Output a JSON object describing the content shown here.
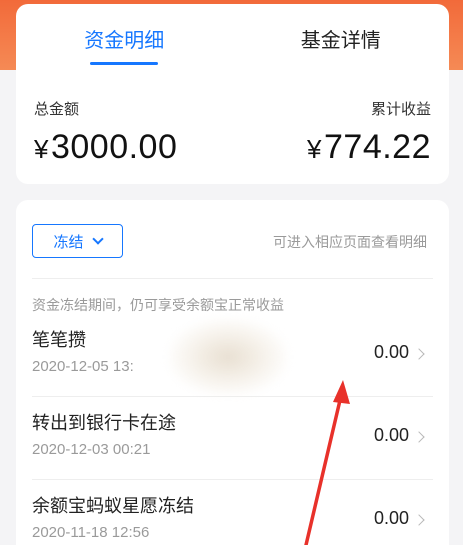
{
  "tabs": [
    {
      "label": "资金明细",
      "active": true
    },
    {
      "label": "基金详情",
      "active": false
    }
  ],
  "summary": {
    "total_label": "总金额",
    "total_currency": "¥",
    "total_value": "3000.00",
    "earnings_label": "累计收益",
    "earnings_currency": "¥",
    "earnings_value": "774.22"
  },
  "filter": {
    "selected": "冻结"
  },
  "hint_text": "可进入相应页面查看明细",
  "note_text": "资金冻结期间，仍可享受余额宝正常收益",
  "records": [
    {
      "title": "笔笔攒",
      "date": "2020-12-05 13:",
      "amount": "0.00"
    },
    {
      "title": "转出到银行卡在途",
      "date": "2020-12-03 00:21",
      "amount": "0.00"
    },
    {
      "title": "余额宝蚂蚁星愿冻结",
      "date": "2020-11-18 12:56",
      "amount": "0.00"
    }
  ],
  "colors": {
    "accent": "#1677ff",
    "brand_orange": "#f26a3a",
    "annotation_red": "#e8312a"
  }
}
